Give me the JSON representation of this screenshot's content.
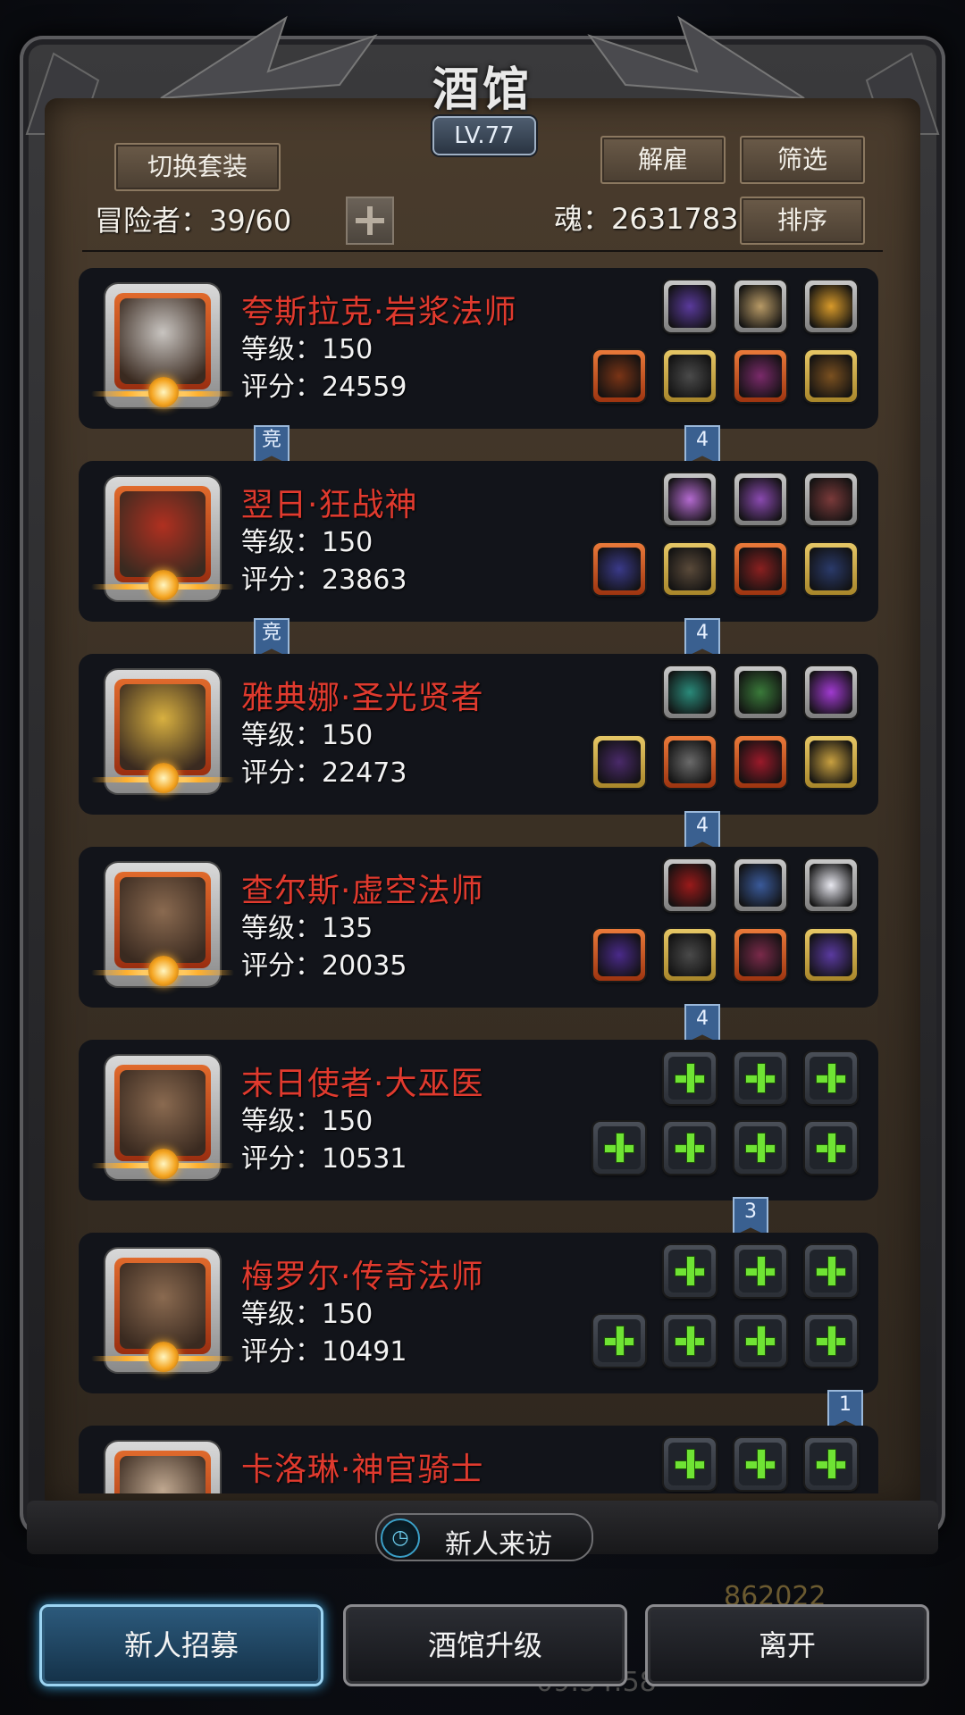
{
  "header": {
    "title": "酒馆",
    "level": "LV.77"
  },
  "toolbar": {
    "switch_outfit": "切换套装",
    "dismiss": "解雇",
    "filter": "筛选",
    "sort": "排序",
    "adventurers_label": "冒险者：39/60",
    "soul_label": "魂：2631783"
  },
  "heroes": [
    {
      "name": "夸斯拉克·岩浆法师",
      "level": "等级：150",
      "score": "评分：24559",
      "badge": "竞",
      "ribbon": "4",
      "slots_top": [
        {
          "frame": "gray",
          "icon": "dark-gem-icon",
          "color": "#5a3a9c"
        },
        {
          "frame": "gray",
          "icon": "compass-icon",
          "color": "#b89a66"
        },
        {
          "frame": "gray",
          "icon": "lantern-icon",
          "color": "#d89a2a"
        }
      ],
      "slots_bottom": [
        {
          "frame": "orange",
          "icon": "bow-icon",
          "color": "#7a3416"
        },
        {
          "frame": "gold",
          "icon": "robe-icon",
          "color": "#4a4a4a"
        },
        {
          "frame": "orange",
          "icon": "amulet-icon",
          "color": "#7a2a6a"
        },
        {
          "frame": "gold",
          "icon": "bracer-icon",
          "color": "#7a5020"
        }
      ]
    },
    {
      "name": "翌日·狂战神",
      "level": "等级：150",
      "score": "评分：23863",
      "badge": "竞",
      "ribbon": "4",
      "slots_top": [
        {
          "frame": "gray",
          "icon": "crystal-icon",
          "color": "#b46ad0"
        },
        {
          "frame": "gray",
          "icon": "lantern-icon",
          "color": "#8a4ab0"
        },
        {
          "frame": "gray",
          "icon": "horn-icon",
          "color": "#7a3a3a"
        }
      ],
      "slots_bottom": [
        {
          "frame": "orange",
          "icon": "staff-icon",
          "color": "#3a3a8a"
        },
        {
          "frame": "gold",
          "icon": "armor-icon",
          "color": "#5a4a3a"
        },
        {
          "frame": "orange",
          "icon": "helmet-icon",
          "color": "#8a2020"
        },
        {
          "frame": "gold",
          "icon": "ring-icon",
          "color": "#2a3a6a"
        }
      ]
    },
    {
      "name": "雅典娜·圣光贤者",
      "level": "等级：150",
      "score": "评分：22473",
      "badge": "",
      "ribbon": "4",
      "slots_top": [
        {
          "frame": "gray",
          "icon": "teal-gem-icon",
          "color": "#2a8a7a"
        },
        {
          "frame": "gray",
          "icon": "lantern-icon",
          "color": "#3a7a3a"
        },
        {
          "frame": "gray",
          "icon": "purple-gem-icon",
          "color": "#a03ad0"
        }
      ],
      "slots_bottom": [
        {
          "frame": "gold",
          "icon": "scepter-icon",
          "color": "#4a2a6a"
        },
        {
          "frame": "orange",
          "icon": "chestplate-icon",
          "color": "#6a6a6a"
        },
        {
          "frame": "orange",
          "icon": "potion-icon",
          "color": "#9a1a2a"
        },
        {
          "frame": "gold",
          "icon": "shield-icon",
          "color": "#c8a040"
        }
      ]
    },
    {
      "name": "查尔斯·虚空法师",
      "level": "等级：135",
      "score": "评分：20035",
      "badge": "",
      "ribbon": "4",
      "slots_top": [
        {
          "frame": "gray",
          "icon": "cape-icon",
          "color": "#9a1a1a"
        },
        {
          "frame": "gray",
          "icon": "lantern-icon",
          "color": "#3a5a9a"
        },
        {
          "frame": "gray",
          "icon": "wing-icon",
          "color": "#e8e8f0"
        }
      ],
      "slots_bottom": [
        {
          "frame": "orange",
          "icon": "wand-icon",
          "color": "#4a2a8a"
        },
        {
          "frame": "gold",
          "icon": "iron-armor-icon",
          "color": "#4a4a4a"
        },
        {
          "frame": "orange",
          "icon": "crest-icon",
          "color": "#7a2a4a"
        },
        {
          "frame": "gold",
          "icon": "bracelet-icon",
          "color": "#5a3aa0"
        }
      ]
    },
    {
      "name": "末日使者·大巫医",
      "level": "等级：150",
      "score": "评分：10531",
      "badge": "",
      "ribbon": "3",
      "slots_top": [
        {
          "frame": "empty"
        },
        {
          "frame": "empty"
        },
        {
          "frame": "empty"
        }
      ],
      "slots_bottom": [
        {
          "frame": "empty"
        },
        {
          "frame": "empty"
        },
        {
          "frame": "empty"
        },
        {
          "frame": "empty"
        }
      ]
    },
    {
      "name": "梅罗尔·传奇法师",
      "level": "等级：150",
      "score": "评分：10491",
      "badge": "",
      "ribbon": "1",
      "slots_top": [
        {
          "frame": "empty"
        },
        {
          "frame": "empty"
        },
        {
          "frame": "empty"
        }
      ],
      "slots_bottom": [
        {
          "frame": "empty"
        },
        {
          "frame": "empty"
        },
        {
          "frame": "empty"
        },
        {
          "frame": "empty"
        }
      ]
    },
    {
      "name": "卡洛琳·神官骑士",
      "level": "",
      "score": "",
      "badge": "",
      "ribbon": "",
      "slots_top": [
        {
          "frame": "empty"
        },
        {
          "frame": "empty"
        },
        {
          "frame": "empty"
        }
      ],
      "slots_bottom": []
    }
  ],
  "portrait_colors": [
    "#c8c4c0",
    "#b03020",
    "#d8b040",
    "#8a6a50",
    "#8a6a50",
    "#8a6a50",
    "#c0a890"
  ],
  "visitor": {
    "label": "新人来访",
    "icon": "clock-icon"
  },
  "background_text": {
    "gold": "862022",
    "time": "09:54:58"
  },
  "bottom_buttons": {
    "recruit": "新人招募",
    "upgrade": "酒馆升级",
    "leave": "离开"
  },
  "colors": {
    "hero_name": "#e03a2e",
    "active_button": "#2c5a7c",
    "plus": "#6fe334"
  }
}
